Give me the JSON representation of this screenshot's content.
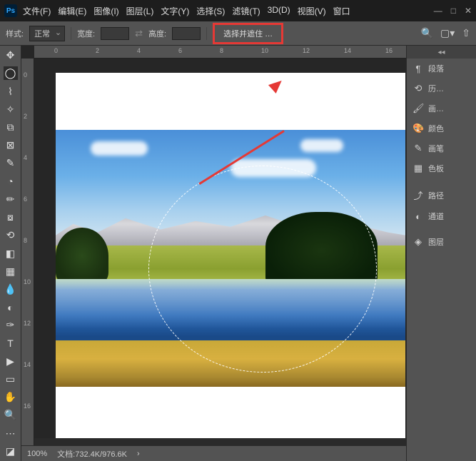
{
  "title_bar": {
    "logo_text": "Ps"
  },
  "menu": {
    "file": "文件(F)",
    "edit": "编辑(E)",
    "image": "图像(I)",
    "layer": "图层(L)",
    "type": "文字(Y)",
    "select": "选择(S)",
    "filter": "滤镜(T)",
    "3d": "3D(D)",
    "view": "视图(V)",
    "window": "窗口"
  },
  "options": {
    "style_label": "样式:",
    "style_value": "正常",
    "width_label": "宽度:",
    "height_label": "高度:",
    "select_mask": "选择并遮住 …"
  },
  "ruler_h": [
    "0",
    "2",
    "4",
    "6",
    "8",
    "10",
    "12",
    "14",
    "16"
  ],
  "ruler_v": [
    "0",
    "2",
    "4",
    "6",
    "8",
    "10",
    "12",
    "14",
    "16"
  ],
  "status": {
    "zoom": "100%",
    "doc_label": "文档:",
    "doc_size": "732.4K/976.6K"
  },
  "panels": {
    "paragraph": "段落",
    "history": "历…",
    "brush_preset": "画…",
    "color": "颜色",
    "brushes": "画笔",
    "swatches": "色板",
    "paths": "路径",
    "channels": "通道",
    "layers": "图层"
  },
  "icons": {
    "minimize": "—",
    "maximize": "□",
    "close": "✕",
    "search": "🔍",
    "docs": "▢▾",
    "share": "⇧"
  }
}
